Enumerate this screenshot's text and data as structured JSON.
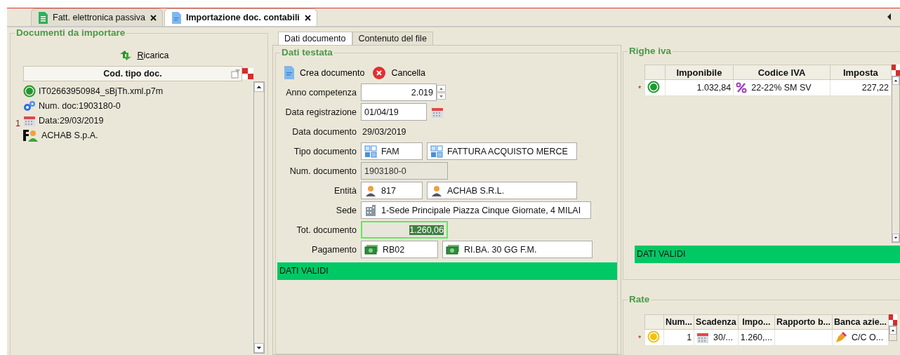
{
  "doc_tabs": [
    {
      "label": "Fatt. elettronica passiva",
      "selected": false
    },
    {
      "label": "Importazione doc. contabili",
      "selected": true
    }
  ],
  "import_panel": {
    "title": "Documenti da importare",
    "reload_label": "Ricarica",
    "column": "Cod. tipo doc.",
    "items": [
      {
        "kind": "status",
        "text": "IT02663950984_sBjTh.xml.p7m"
      },
      {
        "kind": "number",
        "text": "Num. doc:1903180-0"
      },
      {
        "kind": "date",
        "text": "Data:29/03/2019",
        "marker": "1"
      },
      {
        "kind": "company",
        "text": "ACHAB S.p.A."
      }
    ]
  },
  "detail_tabs": [
    {
      "label": "Dati documento",
      "selected": true
    },
    {
      "label": "Contenuto del file",
      "selected": false
    }
  ],
  "header_section": {
    "title": "Dati testata",
    "actions": [
      {
        "kind": "create",
        "label": "Crea documento"
      },
      {
        "kind": "cancel",
        "label": "Cancella"
      }
    ],
    "fields": [
      {
        "kind": "spin",
        "label": "Anno competenza",
        "value": "2.019"
      },
      {
        "kind": "date",
        "label": "Data registrazione",
        "value": "01/04/19"
      },
      {
        "kind": "plain",
        "label": "Data documento",
        "value": "29/03/2019"
      },
      {
        "kind": "doctype",
        "label": "Tipo documento",
        "value": "FAM",
        "description": "FATTURA ACQUISTO MERCE"
      },
      {
        "kind": "readonly",
        "label": "Num. documento",
        "value": "1903180-0"
      },
      {
        "kind": "entity",
        "label": "Entità",
        "value": "817",
        "description": "ACHAB S.R.L."
      },
      {
        "kind": "site",
        "label": "Sede",
        "value": "1-Sede Principale Piazza Cinque Giornate, 4 MILAI"
      },
      {
        "kind": "total",
        "label": "Tot. documento",
        "value": "1.260,06",
        "selected": true
      },
      {
        "kind": "payment",
        "label": "Pagamento",
        "value": "RB02",
        "description": "RI.BA. 30 GG F.M."
      }
    ],
    "status": "DATI VALIDI"
  },
  "vat_section": {
    "title": "Righe iva",
    "columns": [
      "Imponibile",
      "Codice IVA",
      "Imposta"
    ],
    "rows": [
      {
        "marker": "*",
        "color": "#1f9a2e",
        "taxable": "1.032,84",
        "vat_code": "22-22% SM SV",
        "tax": "227,22"
      }
    ],
    "status": "DATI VALIDI"
  },
  "installments_section": {
    "title": "Rate",
    "columns": [
      "Num...",
      "Scadenza",
      "Impo...",
      "Rapporto b...",
      "Banca azie..."
    ],
    "rows": [
      {
        "marker": "*",
        "color": "#f2c20c",
        "number": "1",
        "due": "30/...",
        "amount": "1.260,...",
        "bank": "C/C O..."
      }
    ]
  }
}
